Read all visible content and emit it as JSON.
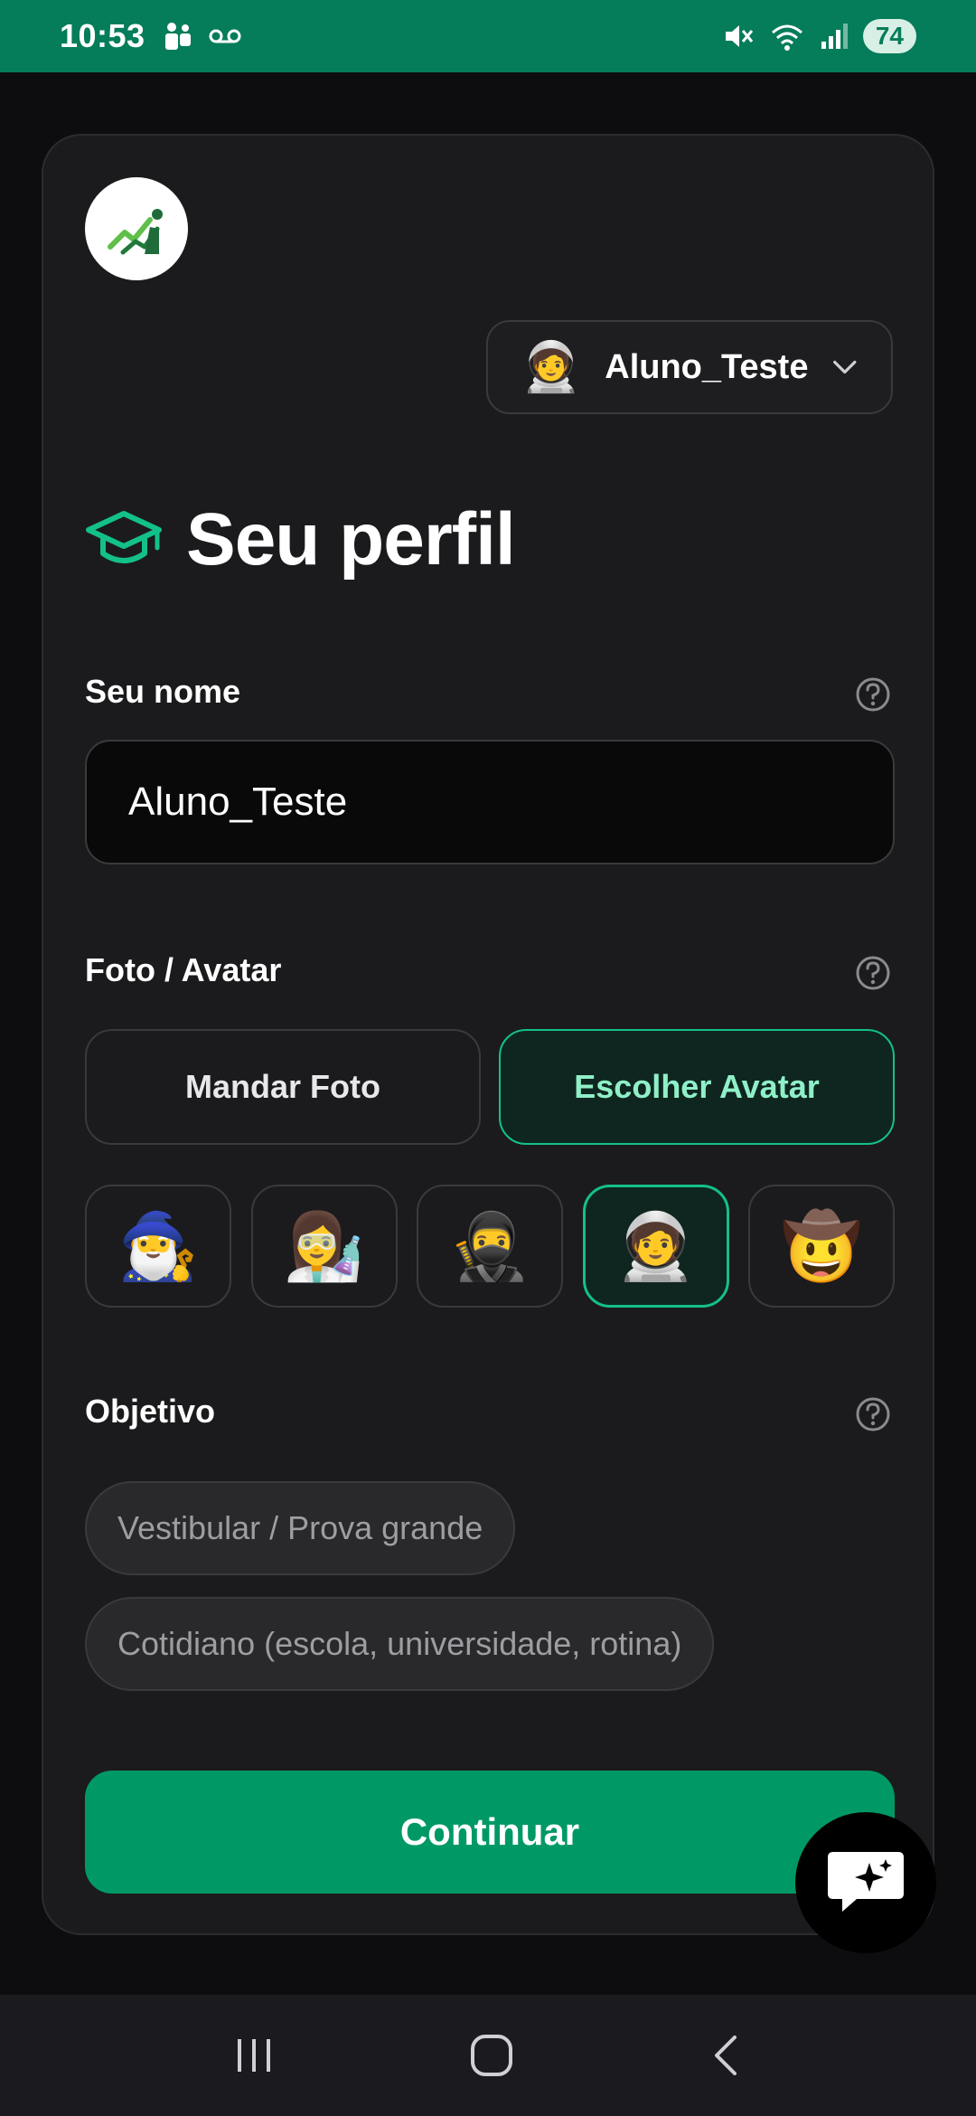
{
  "status_bar": {
    "time": "10:53",
    "battery": "74",
    "icons": [
      "teams-icon",
      "voicemail-icon",
      "mute-icon",
      "wifi-icon",
      "signal-icon"
    ]
  },
  "header": {
    "logo_icon": "app-logo",
    "user_selector": {
      "emoji": "🧑‍🚀",
      "name": "Aluno_Teste"
    }
  },
  "page": {
    "title": "Seu perfil",
    "title_icon": "graduation-cap-icon"
  },
  "name_section": {
    "label": "Seu nome",
    "value": "Aluno_Teste"
  },
  "photo_section": {
    "label": "Foto / Avatar",
    "send_photo_label": "Mandar Foto",
    "choose_avatar_label": "Escolher Avatar",
    "avatars": [
      "🧙‍♂️",
      "👩‍🔬",
      "🥷",
      "🧑‍🚀",
      "🤠"
    ],
    "selected_avatar_index": 3
  },
  "goal_section": {
    "label": "Objetivo",
    "options": [
      "Vestibular / Prova grande",
      "Cotidiano (escola, universidade, rotina)"
    ]
  },
  "actions": {
    "continue_label": "Continuar"
  },
  "colors": {
    "accent": "#009966",
    "accent_light": "#8ff0c8",
    "status_bar": "#057c5a",
    "card_bg": "#1b1b1d"
  }
}
